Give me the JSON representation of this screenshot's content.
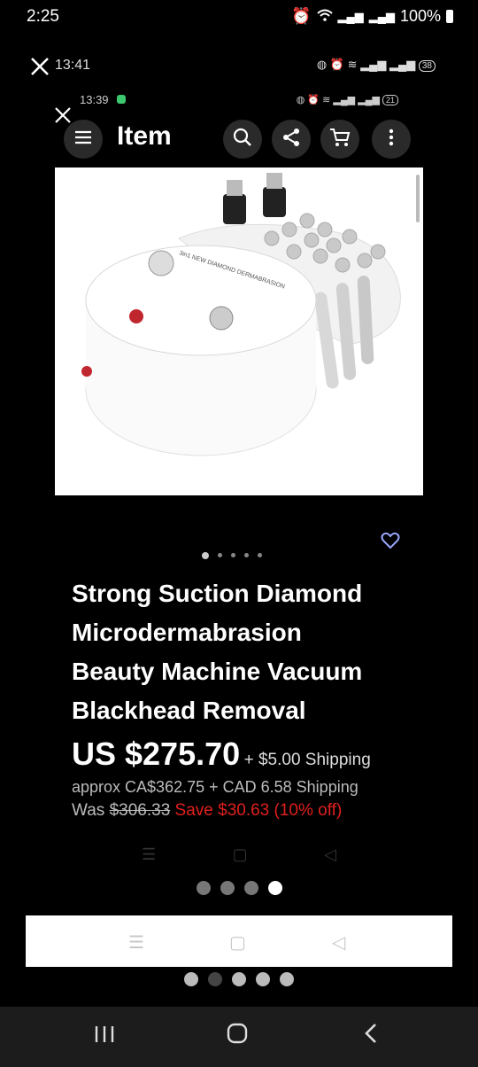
{
  "status_outer": {
    "time": "2:25",
    "battery": "100%"
  },
  "status_mid": {
    "time": "13:41",
    "battery": "38"
  },
  "status_inner": {
    "time": "13:39",
    "battery": "21"
  },
  "appbar": {
    "title": "Item"
  },
  "product": {
    "title_lines": [
      "Strong Suction Diamond",
      "Microdermabrasion",
      "Beauty Machine Vacuum",
      "Blackhead Removal"
    ],
    "price": "US $275.70",
    "shipping": "+ $5.00 Shipping",
    "approx": "approx CA$362.75 + CAD 6.58 Shipping",
    "was_label": "Was",
    "was_price": "$306.33",
    "save": "Save $30.63 (10% off)"
  },
  "image_label": "3in1 NEW DIAMOND DERMABRASION",
  "pager": {
    "image_dots": 5,
    "image_active": 0,
    "screenshot_dots": 4,
    "screenshot_active": 3
  },
  "colors": {
    "accent_heart": "#9aa8ff",
    "save_red": "#e0201d"
  }
}
